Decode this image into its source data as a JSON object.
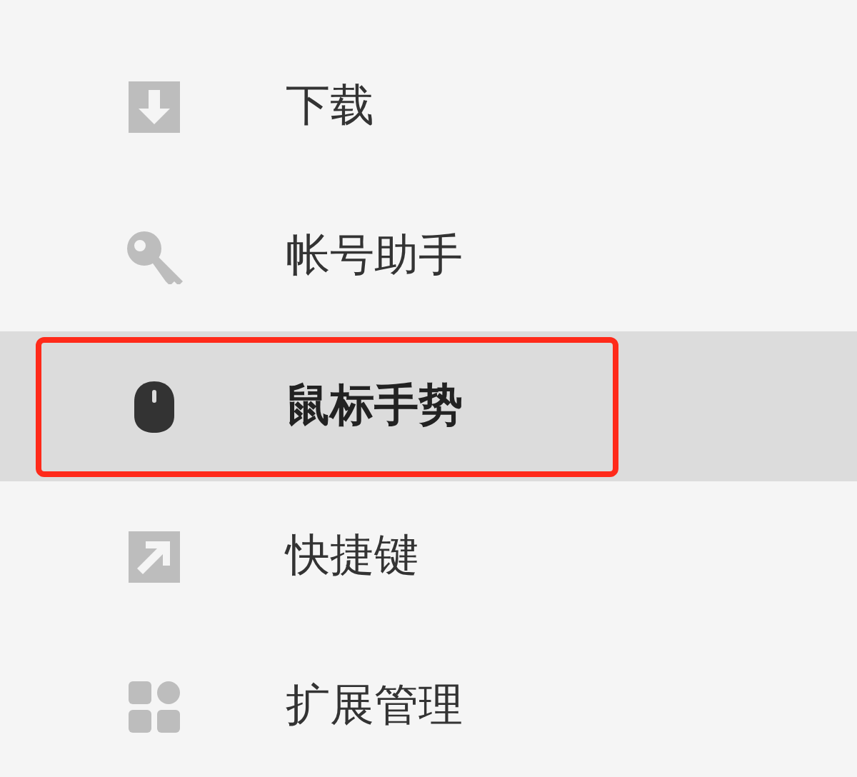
{
  "menu": {
    "items": [
      {
        "label": "下载",
        "selected": false,
        "highlighted": false
      },
      {
        "label": "帐号助手",
        "selected": false,
        "highlighted": false
      },
      {
        "label": "鼠标手势",
        "selected": true,
        "highlighted": true
      },
      {
        "label": "快捷键",
        "selected": false,
        "highlighted": false
      },
      {
        "label": "扩展管理",
        "selected": false,
        "highlighted": false
      }
    ]
  }
}
